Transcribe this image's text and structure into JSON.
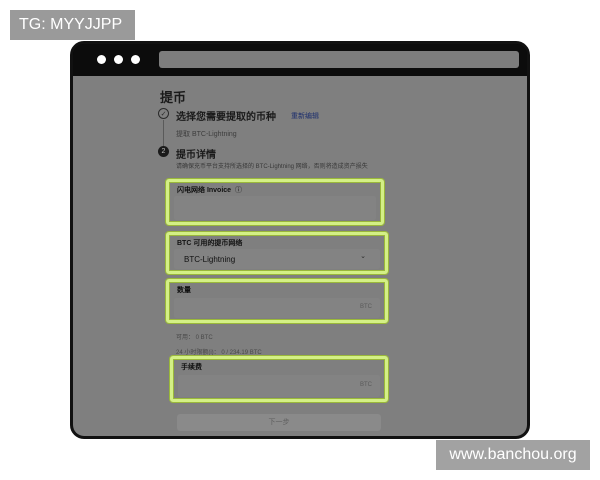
{
  "watermarks": {
    "telegram": "TG: MYYJJPP",
    "site": "www.banchou.org"
  },
  "page": {
    "title": "提币"
  },
  "step1": {
    "number": "✓",
    "title": "选择您需要提取的币种",
    "reselect_label": "重新编辑",
    "selected_note": "提取 BTC-Lightning"
  },
  "step2": {
    "number": "2",
    "title": "提币详情",
    "description": "请确保充币平台支持所选择的 BTC-Lightning 网络，否则将造成资产损失"
  },
  "fields": {
    "invoice": {
      "label": "闪电网络 Invoice",
      "info_icon": "ⓘ",
      "value": ""
    },
    "network": {
      "label": "BTC 可用的提币网络",
      "value": "BTC-Lightning",
      "chevron": "⌄"
    },
    "amount": {
      "label": "数量",
      "value": "",
      "unit": "BTC"
    },
    "fee": {
      "label": "手续费",
      "value": "",
      "unit": "BTC"
    }
  },
  "info": {
    "available": "可用：  0 BTC",
    "daily_limit": "24 小时限额(i)：  0 / 234.19 BTC"
  },
  "next_button": {
    "label": "下一步"
  },
  "colors": {
    "highlight": "#d4f086",
    "overlay": "#7f7f7f",
    "link": "#1d2f6d"
  }
}
